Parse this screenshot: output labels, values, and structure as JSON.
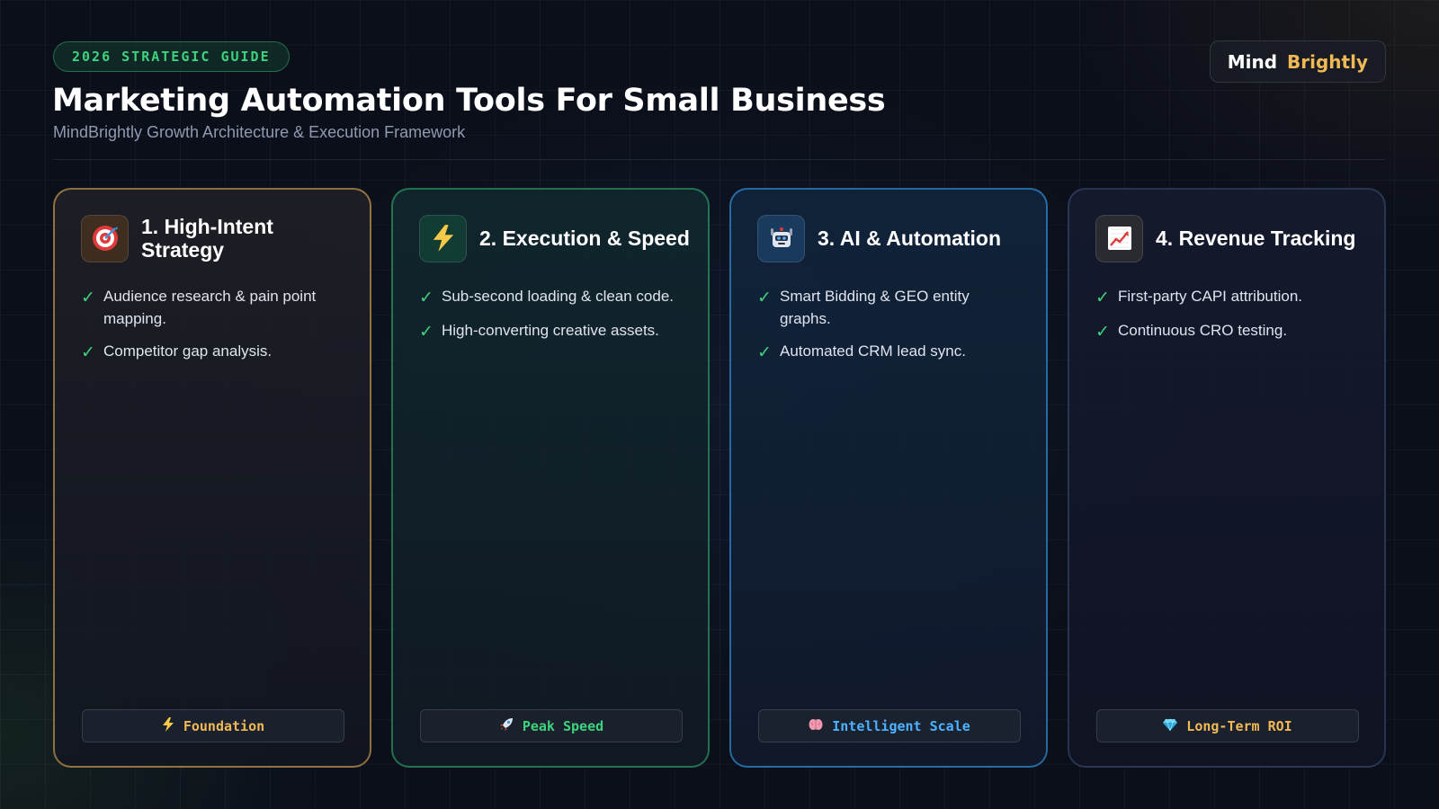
{
  "header": {
    "pill": "2026 STRATEGIC GUIDE",
    "title": "Marketing Automation Tools For Small Business",
    "subtitle": "MindBrightly Growth Architecture & Execution Framework"
  },
  "brand": {
    "part1": "Mind",
    "part2": "Brightly"
  },
  "cards": [
    {
      "title": "1. High-Intent Strategy",
      "icon": "target-icon",
      "accent": "#d2a050",
      "bullets": [
        "Audience research & pain point mapping.",
        "Competitor gap analysis."
      ],
      "tag": "Foundation",
      "tag_icon": "lightning-icon"
    },
    {
      "title": "2. Execution & Speed",
      "icon": "lightning-icon",
      "accent": "#32aa6e",
      "bullets": [
        "Sub-second loading & clean code.",
        "High-converting creative assets."
      ],
      "tag": "Peak Speed",
      "tag_icon": "rocket-icon"
    },
    {
      "title": "3. AI & Automation",
      "icon": "robot-icon",
      "accent": "#328cd2",
      "bullets": [
        "Smart Bidding & GEO entity graphs.",
        "Automated CRM lead sync."
      ],
      "tag": "Intelligent Scale",
      "tag_icon": "brain-icon"
    },
    {
      "title": "4. Revenue Tracking",
      "icon": "chart-up-icon",
      "accent": "#3c5078",
      "bullets": [
        "First-party CAPI attribution.",
        "Continuous CRO testing."
      ],
      "tag": "Long-Term ROI",
      "tag_icon": "diamond-icon"
    }
  ],
  "colors": {
    "background": "#0b0f1a",
    "green": "#3ed27f",
    "gold": "#f0b955",
    "blue": "#4db2ff"
  }
}
